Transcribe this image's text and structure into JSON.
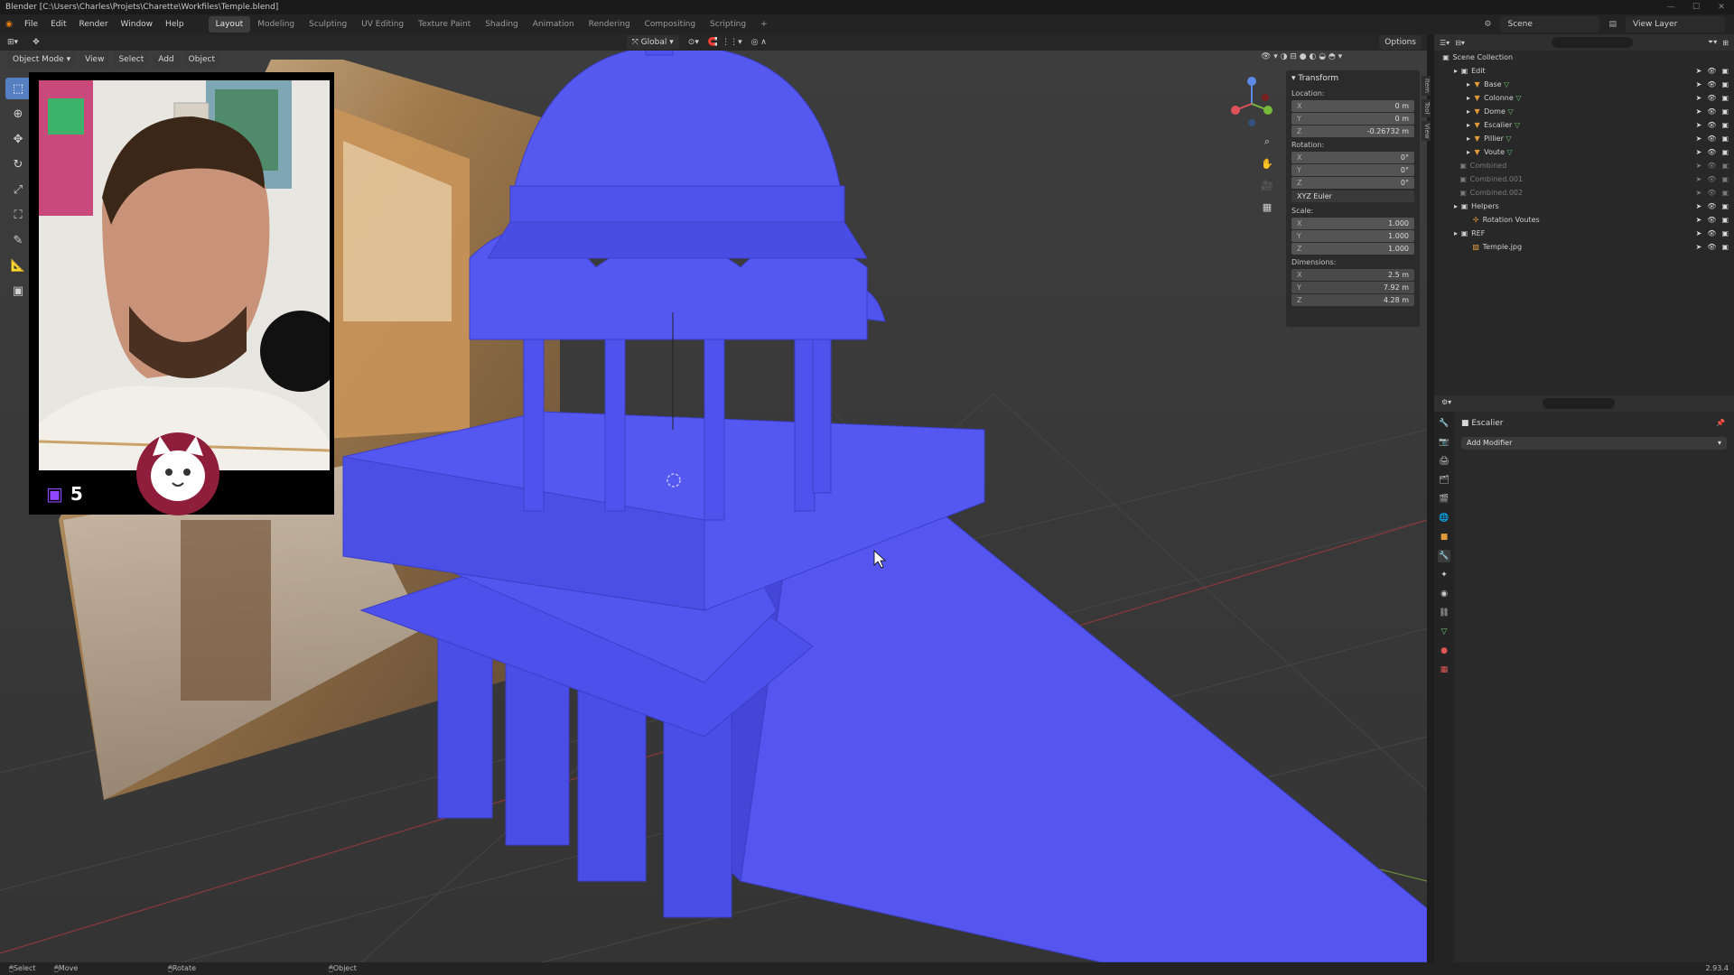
{
  "window": {
    "title": "Blender [C:\\Users\\Charles\\Projets\\Charette\\Workfiles\\Temple.blend]"
  },
  "menus": [
    "File",
    "Edit",
    "Render",
    "Window",
    "Help"
  ],
  "workspaces": [
    "Layout",
    "Modeling",
    "Sculpting",
    "UV Editing",
    "Texture Paint",
    "Shading",
    "Animation",
    "Rendering",
    "Compositing",
    "Scripting",
    "+"
  ],
  "active_workspace": "Layout",
  "scene_field": "Scene",
  "view_layer_field": "View Layer",
  "viewport_header": {
    "mode": "Object Mode",
    "view": "View",
    "select": "Select",
    "add": "Add",
    "object": "Object",
    "orientation": "Global",
    "options": "Options"
  },
  "webcam": {
    "viewer_count": "5"
  },
  "transform_panel": {
    "title": "Transform",
    "location_label": "Location:",
    "location": [
      {
        "axis": "X",
        "value": "0 m"
      },
      {
        "axis": "Y",
        "value": "0 m"
      },
      {
        "axis": "Z",
        "value": "-0.26732 m"
      }
    ],
    "rotation_label": "Rotation:",
    "rotation": [
      {
        "axis": "X",
        "value": "0°"
      },
      {
        "axis": "Y",
        "value": "0°"
      },
      {
        "axis": "Z",
        "value": "0°"
      }
    ],
    "rotation_mode": "XYZ Euler",
    "scale_label": "Scale:",
    "scale": [
      {
        "axis": "X",
        "value": "1.000"
      },
      {
        "axis": "Y",
        "value": "1.000"
      },
      {
        "axis": "Z",
        "value": "1.000"
      }
    ],
    "dimensions_label": "Dimensions:",
    "dimensions": [
      {
        "axis": "X",
        "value": "2.5 m"
      },
      {
        "axis": "Y",
        "value": "7.92 m"
      },
      {
        "axis": "Z",
        "value": "4.28 m"
      }
    ]
  },
  "sidebar_tabs": [
    "Item",
    "Tool",
    "View"
  ],
  "outliner": {
    "root": "Scene Collection",
    "items": [
      {
        "name": "Edit",
        "type": "collection",
        "level": 1
      },
      {
        "name": "Base",
        "type": "mesh",
        "level": 2
      },
      {
        "name": "Colonne",
        "type": "mesh",
        "level": 2
      },
      {
        "name": "Dome",
        "type": "mesh",
        "level": 2
      },
      {
        "name": "Escalier",
        "type": "mesh",
        "level": 2
      },
      {
        "name": "Pillier",
        "type": "mesh",
        "level": 2
      },
      {
        "name": "Voute",
        "type": "mesh",
        "level": 2
      },
      {
        "name": "Combined",
        "type": "collection-dim",
        "level": 1
      },
      {
        "name": "Combined.001",
        "type": "collection-dim",
        "level": 1
      },
      {
        "name": "Combined.002",
        "type": "collection-dim",
        "level": 1
      },
      {
        "name": "Helpers",
        "type": "collection",
        "level": 1
      },
      {
        "name": "Rotation Voutes",
        "type": "empty",
        "level": 2
      },
      {
        "name": "REF",
        "type": "collection",
        "level": 1
      },
      {
        "name": "Temple.jpg",
        "type": "image",
        "level": 2
      }
    ]
  },
  "properties": {
    "object_name": "Escalier",
    "add_modifier": "Add Modifier"
  },
  "status_bar": {
    "select": "Select",
    "move": "Move",
    "rotate_view": "Rotate View",
    "context_menu": "Object Context Menu",
    "version": "2.93.4"
  },
  "colors": {
    "model": "#4f52ec",
    "accent": "#5680c2",
    "bg": "#1d1d1d"
  }
}
